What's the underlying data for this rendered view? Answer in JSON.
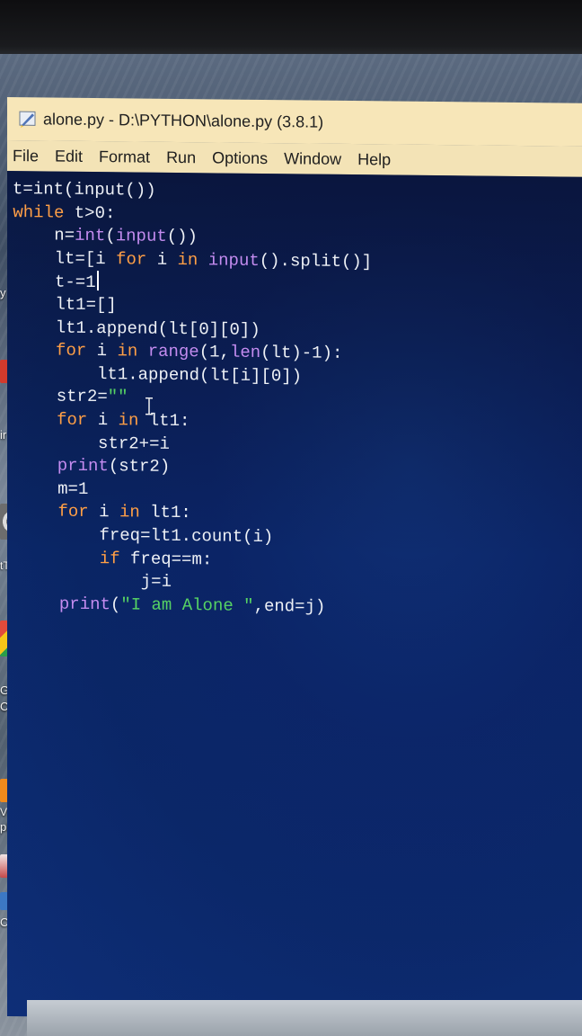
{
  "window": {
    "title": "alone.py - D:\\PYTHON\\alone.py (3.8.1)"
  },
  "menu": {
    "items": [
      "File",
      "Edit",
      "Format",
      "Run",
      "Options",
      "Window",
      "Help"
    ]
  },
  "desktop_icons": {
    "labels": [
      "y",
      "ir",
      "tT",
      "Go",
      "Ch",
      "VLC",
      "pl",
      "Code"
    ]
  },
  "code": {
    "lines": [
      [
        {
          "c": "txt",
          "t": "t=int(input())"
        }
      ],
      [
        {
          "c": "kw",
          "t": "while"
        },
        {
          "c": "txt",
          "t": " t>0:"
        }
      ],
      [
        {
          "c": "txt",
          "t": "    n="
        },
        {
          "c": "bi",
          "t": "int"
        },
        {
          "c": "txt",
          "t": "("
        },
        {
          "c": "bi",
          "t": "input"
        },
        {
          "c": "txt",
          "t": "())"
        }
      ],
      [
        {
          "c": "txt",
          "t": "    lt=[i "
        },
        {
          "c": "kw",
          "t": "for"
        },
        {
          "c": "txt",
          "t": " i "
        },
        {
          "c": "kw",
          "t": "in"
        },
        {
          "c": "txt",
          "t": " "
        },
        {
          "c": "bi",
          "t": "input"
        },
        {
          "c": "txt",
          "t": "().split()]"
        }
      ],
      [
        {
          "c": "txt",
          "t": "    t-=1"
        }
      ],
      [
        {
          "c": "txt",
          "t": "    lt1=[]"
        }
      ],
      [
        {
          "c": "txt",
          "t": "    lt1.append(lt[0][0])"
        }
      ],
      [
        {
          "c": "kw",
          "t": "    for"
        },
        {
          "c": "txt",
          "t": " i "
        },
        {
          "c": "kw",
          "t": "in"
        },
        {
          "c": "txt",
          "t": " "
        },
        {
          "c": "bi",
          "t": "range"
        },
        {
          "c": "txt",
          "t": "(1,"
        },
        {
          "c": "bi",
          "t": "len"
        },
        {
          "c": "txt",
          "t": "(lt)-1):"
        }
      ],
      [
        {
          "c": "txt",
          "t": "        lt1.append(lt[i][0])"
        }
      ],
      [
        {
          "c": "txt",
          "t": "    str2="
        },
        {
          "c": "str",
          "t": "\"\""
        }
      ],
      [
        {
          "c": "kw",
          "t": "    for"
        },
        {
          "c": "txt",
          "t": " i "
        },
        {
          "c": "kw",
          "t": "in"
        },
        {
          "c": "txt",
          "t": " lt1:"
        }
      ],
      [
        {
          "c": "txt",
          "t": "        str2+=i"
        }
      ],
      [
        {
          "c": "bi",
          "t": "    print"
        },
        {
          "c": "txt",
          "t": "(str2)"
        }
      ],
      [
        {
          "c": "txt",
          "t": "    m=1"
        }
      ],
      [
        {
          "c": "kw",
          "t": "    for"
        },
        {
          "c": "txt",
          "t": " i "
        },
        {
          "c": "kw",
          "t": "in"
        },
        {
          "c": "txt",
          "t": " lt1:"
        }
      ],
      [
        {
          "c": "txt",
          "t": "        freq=lt1.count(i)"
        }
      ],
      [
        {
          "c": "kw",
          "t": "        if"
        },
        {
          "c": "txt",
          "t": " freq==m:"
        }
      ],
      [
        {
          "c": "txt",
          "t": "            j=i"
        }
      ],
      [
        {
          "c": "bi",
          "t": "    print"
        },
        {
          "c": "txt",
          "t": "("
        },
        {
          "c": "str",
          "t": "\"I am Alone \""
        },
        {
          "c": "txt",
          "t": ",end=j)"
        }
      ]
    ]
  },
  "colors": {
    "titlebar": "#f7e6b8",
    "editor_bg": "#0b2466",
    "keyword": "#ff9f46",
    "builtin": "#c48cf0",
    "string": "#56d364",
    "text": "#eef1f6"
  }
}
